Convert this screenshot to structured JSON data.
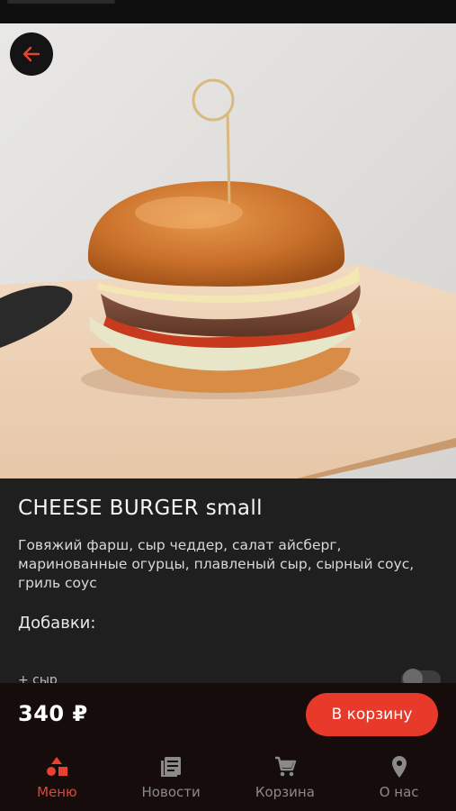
{
  "product": {
    "name": "CHEESE BURGER small",
    "description": "Говяжий фарш, сыр чеддер, салат айсберг, маринованные огурцы, плавленый сыр, сырный соус, гриль соус",
    "addons_label": "Добавки:",
    "addon_partial": "+ сыр",
    "price": "340 ₽"
  },
  "actions": {
    "add_to_cart": "В корзину"
  },
  "nav": [
    {
      "label": "Меню",
      "icon": "shapes-icon",
      "active": true
    },
    {
      "label": "Новости",
      "icon": "news-icon",
      "active": false
    },
    {
      "label": "Корзина",
      "icon": "cart-icon",
      "active": false
    },
    {
      "label": "О нас",
      "icon": "location-pin-icon",
      "active": false
    }
  ],
  "colors": {
    "accent": "#e83a2b",
    "background": "#1f1f1f",
    "bar": "#160c0c"
  }
}
